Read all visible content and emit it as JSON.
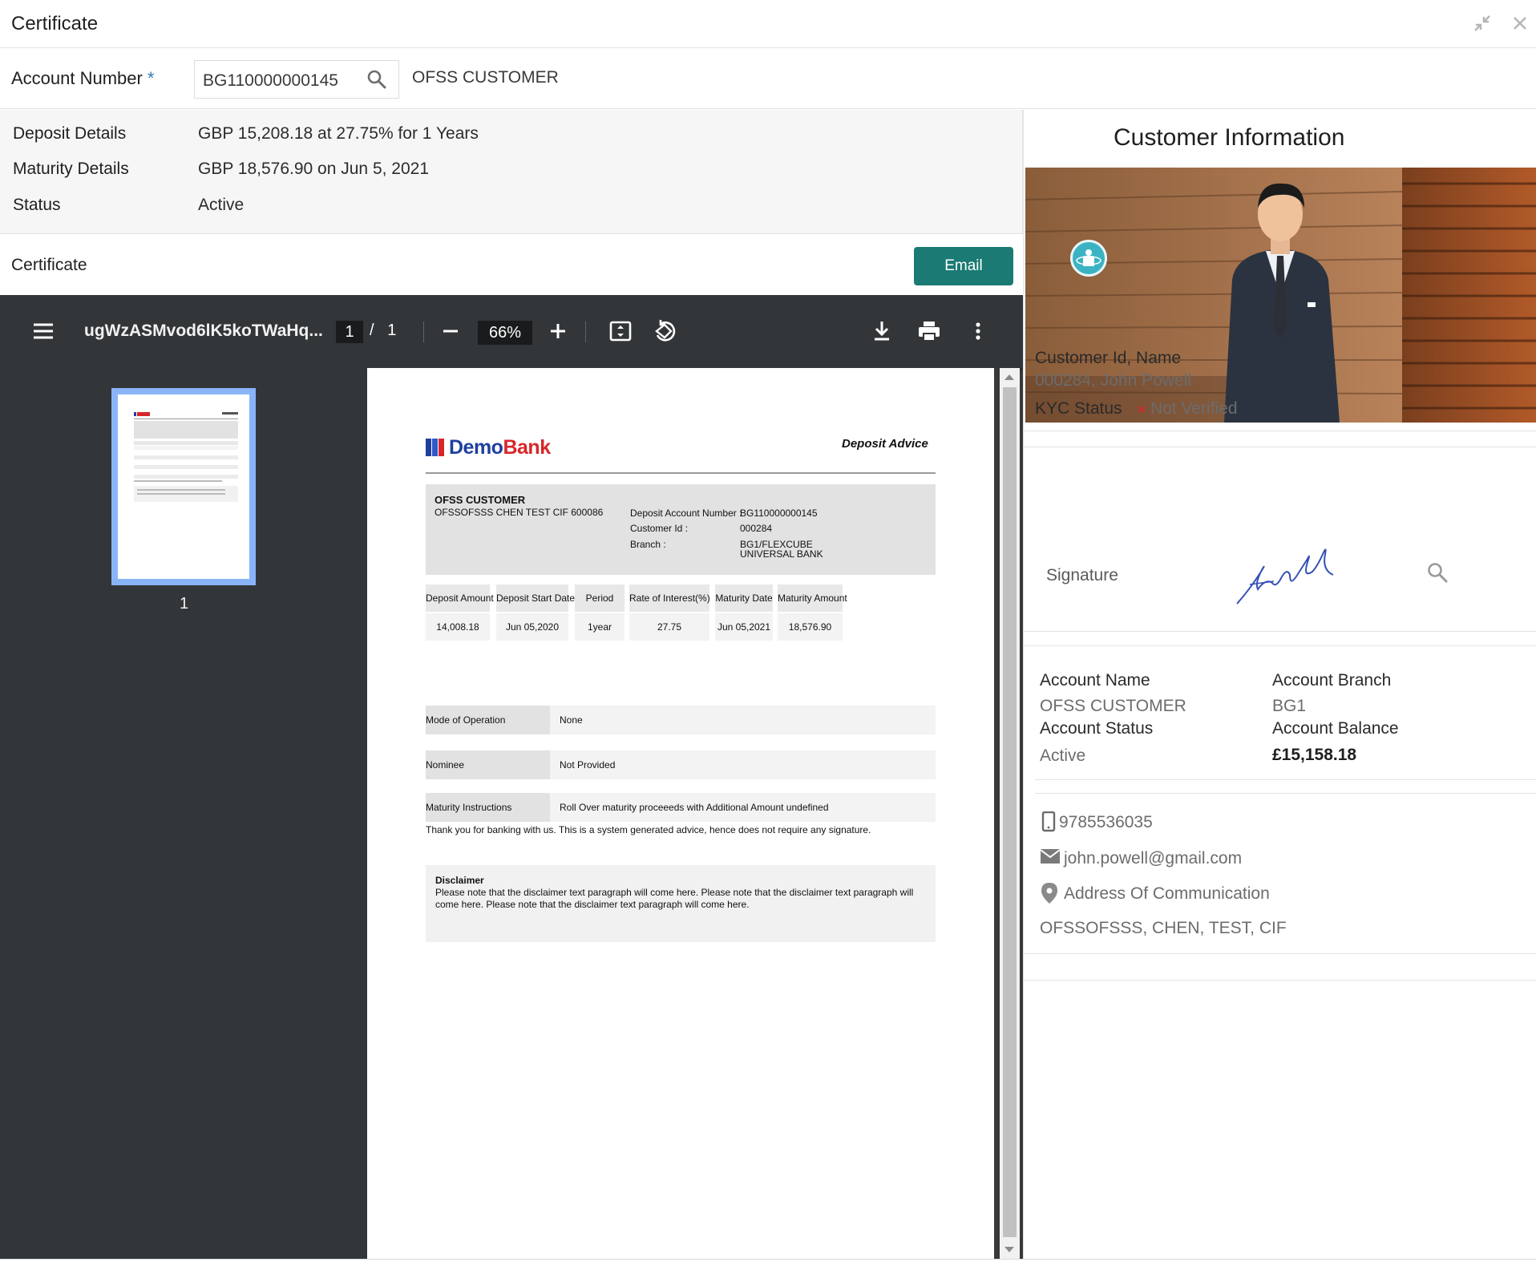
{
  "window": {
    "title": "Certificate",
    "collapse_icon": "collapse-arrows-icon",
    "close_icon": "close-icon"
  },
  "account": {
    "label": "Account Number",
    "required_mark": "*",
    "value": "BG110000000145",
    "customer": "OFSS CUSTOMER",
    "search_icon": "search-icon"
  },
  "details": [
    {
      "label": "Deposit Details",
      "value": "GBP 15,208.18 at 27.75% for 1 Years"
    },
    {
      "label": "Maturity Details",
      "value": "GBP 18,576.90 on Jun 5, 2021"
    },
    {
      "label": "Status",
      "value": "Active"
    }
  ],
  "certificate": {
    "label": "Certificate",
    "email_button": "Email"
  },
  "pdf_viewer": {
    "file_name": "ugWzASMvod6lK5koTWaHq...",
    "page_current": "1",
    "page_separator": "/",
    "page_total": "1",
    "zoom": "66%",
    "thumbnail_label": "1",
    "icons": [
      "menu-icon",
      "zoom-out-icon",
      "zoom-in-icon",
      "fit-page-icon",
      "rotate-icon",
      "download-icon",
      "print-icon",
      "more-vert-icon"
    ]
  },
  "document": {
    "logo_demo": "Demo",
    "logo_bank": "Bank",
    "doc_title": "Deposit Advice",
    "customer_name": "OFSS CUSTOMER",
    "customer_sub": "OFSSOFSSS CHEN TEST CIF 600086",
    "deposit_account_label": "Deposit Account Number :",
    "deposit_account_value": "BG110000000145",
    "customer_id_label": "Customer Id :",
    "customer_id_value": "000284",
    "branch_label": "Branch :",
    "branch_value_1": "BG1/FLEXCUBE",
    "branch_value_2": "UNIVERSAL BANK",
    "columns": [
      {
        "header": "Deposit Amount",
        "value": "14,008.18"
      },
      {
        "header": "Deposit Start Date",
        "value": "Jun 05,2020"
      },
      {
        "header": "Period",
        "value": "1year"
      },
      {
        "header": "Rate of Interest(%)",
        "value": "27.75"
      },
      {
        "header": "Maturity Date",
        "value": "Jun 05,2021"
      },
      {
        "header": "Maturity Amount",
        "value": "18,576.90"
      }
    ],
    "mode_label": "Mode of Operation",
    "mode_value": "None",
    "nominee_label": "Nominee",
    "nominee_value": "Not Provided",
    "maturity_label": "Maturity Instructions",
    "maturity_value": "Roll Over maturity proceeeds with Additional Amount undefined",
    "thanks": "Thank you for banking with us. This is a system generated advice, hence does not require any signature.",
    "disclaimer_title": "Disclaimer",
    "disclaimer_text": "Please note that the disclaimer text paragraph will come here. Please note that the disclaimer text paragraph will come here. Please note that the disclaimer text paragraph will come here."
  },
  "customer_info": {
    "title": "Customer Information",
    "id_name_label": "Customer Id, Name",
    "id_name_value": "000284, John Powell",
    "kyc_label": "KYC Status",
    "kyc_mark": "×",
    "kyc_value": "Not Verified",
    "signature_label": "Signature",
    "account_name_label": "Account Name",
    "account_name_value": "OFSS CUSTOMER",
    "account_branch_label": "Account Branch",
    "account_branch_value": "BG1",
    "account_status_label": "Account Status",
    "account_status_value": "Active",
    "account_balance_label": "Account Balance",
    "account_balance_value": "£15,158.18",
    "phone": "9785536035",
    "email": "john.powell@gmail.com",
    "address_label": "Address Of Communication",
    "address_value": "OFSSOFSSS, CHEN, TEST, CIF",
    "icons": [
      "phone-icon",
      "mail-icon",
      "location-pin-icon",
      "magnify-icon"
    ]
  }
}
